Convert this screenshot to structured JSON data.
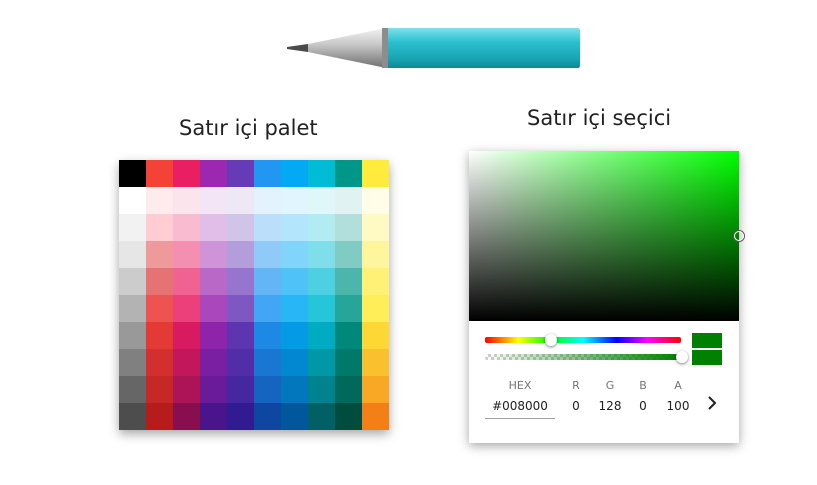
{
  "headings": {
    "palette": "Satır içi palet",
    "picker": "Satır içi seçici"
  },
  "pen": {
    "body_color": "#22b5c3",
    "tip_color": "#b8b8b8"
  },
  "palette": {
    "rows": [
      [
        "#000000",
        "#f44336",
        "#e91e63",
        "#9c27b0",
        "#673ab7",
        "#2196f3",
        "#03a9f4",
        "#00bcd4",
        "#009688",
        "#ffeb3b"
      ],
      [
        "#ffffff",
        "#ffebee",
        "#fce4ec",
        "#f3e5f5",
        "#ede7f6",
        "#e3f2fd",
        "#e1f5fe",
        "#e0f7fa",
        "#e0f2f1",
        "#fffde7"
      ],
      [
        "#f2f2f2",
        "#ffcdd2",
        "#f8bbd0",
        "#e1bee7",
        "#d1c4e9",
        "#bbdefb",
        "#b3e5fc",
        "#b2ebf2",
        "#b2dfdb",
        "#fff9c4"
      ],
      [
        "#e6e6e6",
        "#ef9a9a",
        "#f48fb1",
        "#ce93d8",
        "#b39ddb",
        "#90caf9",
        "#81d4fa",
        "#80deea",
        "#80cbc4",
        "#fff59d"
      ],
      [
        "#cccccc",
        "#e57373",
        "#f06292",
        "#ba68c8",
        "#9575cd",
        "#64b5f6",
        "#4fc3f7",
        "#4dd0e1",
        "#4db6ac",
        "#fff176"
      ],
      [
        "#b3b3b3",
        "#ef5350",
        "#ec407a",
        "#ab47bc",
        "#7e57c2",
        "#42a5f5",
        "#29b6f6",
        "#26c6da",
        "#26a69a",
        "#ffee58"
      ],
      [
        "#999999",
        "#e53935",
        "#d81b60",
        "#8e24aa",
        "#5e35b1",
        "#1e88e5",
        "#039be5",
        "#00acc1",
        "#00897b",
        "#fdd835"
      ],
      [
        "#808080",
        "#d32f2f",
        "#c2185b",
        "#7b1fa2",
        "#512da8",
        "#1976d2",
        "#0288d1",
        "#0097a7",
        "#00796b",
        "#fbc02d"
      ],
      [
        "#666666",
        "#c62828",
        "#ad1457",
        "#6a1b9a",
        "#4527a0",
        "#1565c0",
        "#0277bd",
        "#00838f",
        "#00695c",
        "#f9a825"
      ],
      [
        "#4d4d4d",
        "#b71c1c",
        "#880e4f",
        "#4a148c",
        "#311b92",
        "#0d47a1",
        "#01579b",
        "#006064",
        "#004d40",
        "#f57f17"
      ]
    ]
  },
  "picker": {
    "hue_color": "#00ff00",
    "selected_color": "#008000",
    "labels": {
      "hex": "HEX",
      "r": "R",
      "g": "G",
      "b": "B",
      "a": "A"
    },
    "values": {
      "hex": "#008000",
      "r": "0",
      "g": "128",
      "b": "0",
      "a": "100"
    },
    "mode_switch_icon": "chevron-right-icon"
  }
}
